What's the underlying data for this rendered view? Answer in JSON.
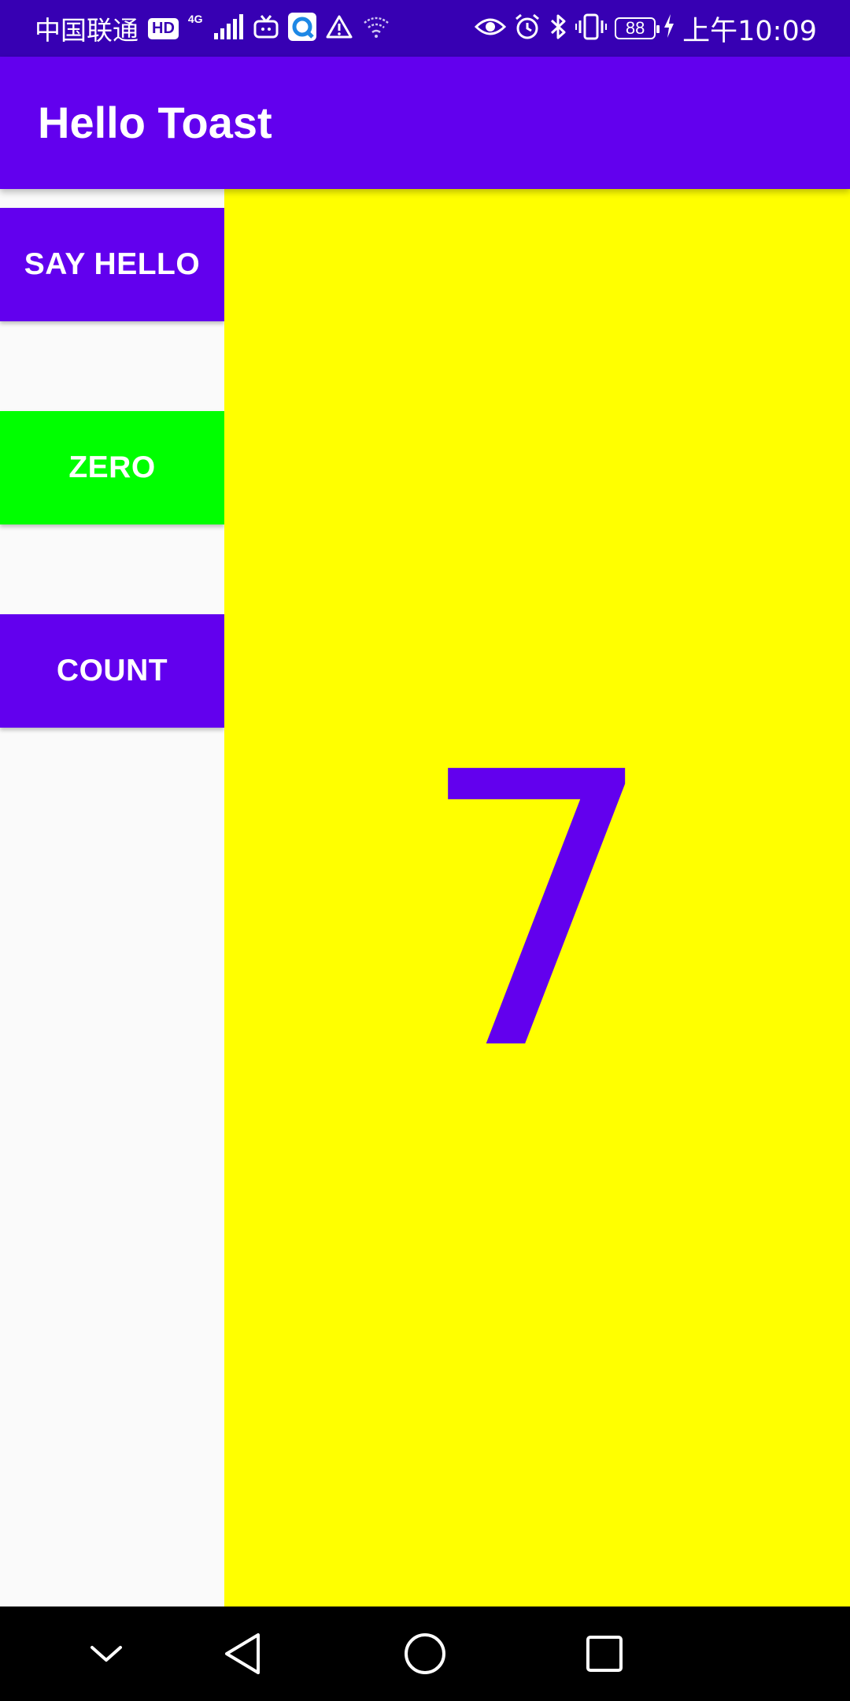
{
  "status_bar": {
    "carrier": "中国联通",
    "hd_badge": "HD",
    "network_type": "4G",
    "battery_level": "88",
    "time": "上午10:09",
    "icons": [
      "signal-icon",
      "tv-icon",
      "app-notification-icon",
      "warning-icon",
      "wifi-icon",
      "eye-icon",
      "alarm-icon",
      "bluetooth-icon",
      "vibrate-icon",
      "battery-icon",
      "charging-icon"
    ]
  },
  "app_bar": {
    "title": "Hello Toast",
    "color": "#6200ee"
  },
  "buttons": {
    "say_hello": "SAY HELLO",
    "zero": "ZERO",
    "count": "COUNT"
  },
  "count_display": {
    "value": "7",
    "background_color": "#ffff00",
    "text_color": "#6200ee"
  },
  "colors": {
    "primary": "#6200ee",
    "primary_dark": "#3700b3",
    "zero_button": "#00ff00"
  },
  "nav_bar": {
    "icons": [
      "collapse-icon",
      "back-icon",
      "home-icon",
      "recents-icon"
    ]
  }
}
